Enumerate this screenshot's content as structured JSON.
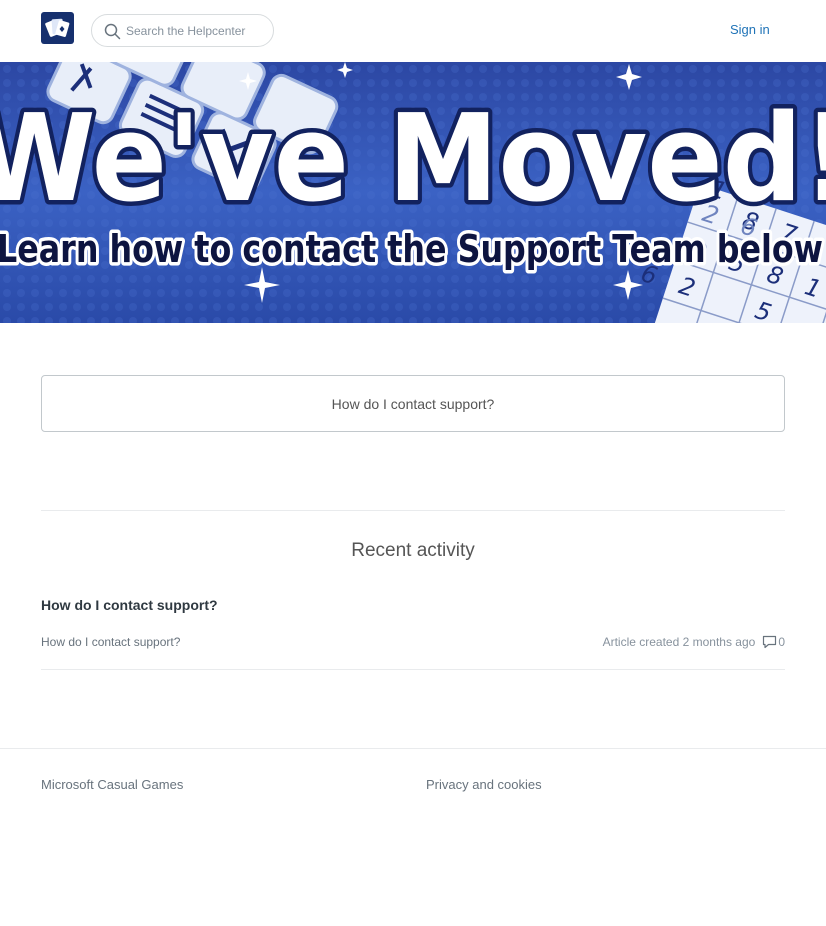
{
  "header": {
    "search_placeholder": "Search the Helpcenter",
    "sign_in": "Sign in"
  },
  "hero": {
    "headline": "We've Moved!",
    "subheadline": "Learn how to contact the Support Team below",
    "sudoku_digits": [
      "1",
      "8",
      "7",
      "2",
      "6",
      "9",
      "5",
      "8",
      "2",
      "6",
      "5",
      "1"
    ]
  },
  "promoted": {
    "link_label": "How do I contact support?"
  },
  "recent_activity": {
    "title": "Recent activity",
    "items": [
      {
        "title": "How do I contact support?",
        "link": "How do I contact support?",
        "meta": "Article created 2 months ago",
        "comment_count": "0"
      }
    ]
  },
  "footer": {
    "company": "Microsoft Casual Games",
    "privacy": "Privacy and cookies"
  },
  "colors": {
    "hero_blue": "#2d4fb0",
    "link_blue": "#1f73b7",
    "logo_navy": "#16306e"
  }
}
